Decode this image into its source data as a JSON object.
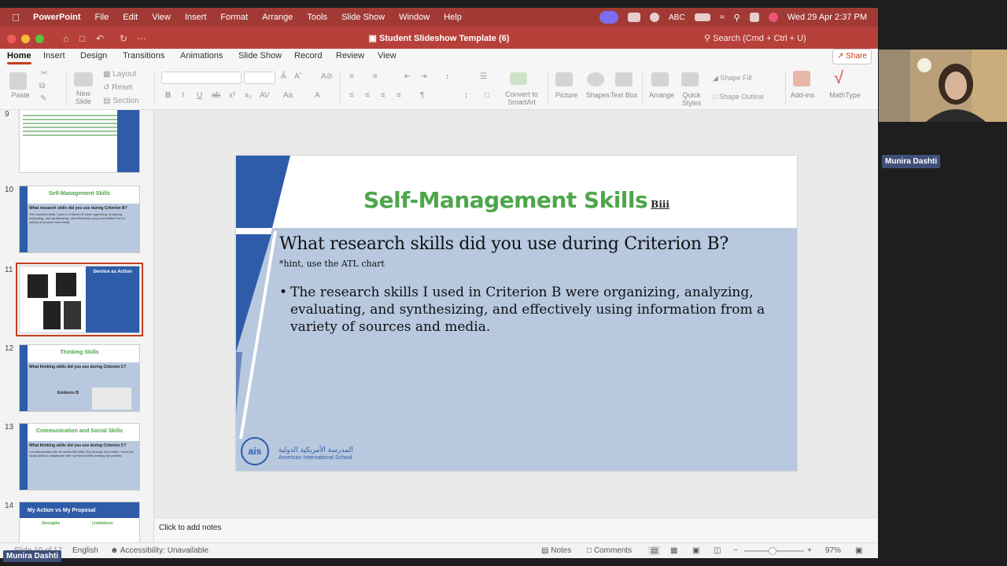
{
  "menubar": {
    "app": "PowerPoint",
    "items": [
      "File",
      "Edit",
      "View",
      "Insert",
      "Format",
      "Arrange",
      "Tools",
      "Slide Show",
      "Window",
      "Help"
    ],
    "input_label": "ABC",
    "clock": "Wed 29 Apr  2:37 PM"
  },
  "window": {
    "title": "Student Slideshow Template (6)",
    "search_placeholder": "Search (Cmd + Ctrl + U)"
  },
  "ribbon": {
    "tabs": [
      "Home",
      "Insert",
      "Design",
      "Transitions",
      "Animations",
      "Slide Show",
      "Record",
      "Review",
      "View"
    ],
    "active_tab": "Home",
    "share_label": "Share",
    "paste": "Paste",
    "new_slide": "New Slide",
    "layout": "Layout",
    "reset": "Reset",
    "section": "Section",
    "convert": "Convert to SmartArt",
    "picture": "Picture",
    "shapes": "Shapes",
    "text_box": "Text Box",
    "arrange": "Arrange",
    "quick_styles": "Quick Styles",
    "shape_fill": "Shape Fill",
    "shape_outline": "Shape Outline",
    "addins": "Add-ins",
    "mathtype": "MathType"
  },
  "thumbnails": [
    {
      "num": "9",
      "title": "",
      "question": "",
      "text": ""
    },
    {
      "num": "10",
      "title": "Self-Management Skills",
      "question": "What research skills did you use during Criterion B?",
      "text": "The research skills I used in Criterion B were organizing, analyzing, evaluating, and synthesizing, and effectively using information from a variety of sources and media."
    },
    {
      "num": "11",
      "title": "Service as Action",
      "question": "",
      "text": ""
    },
    {
      "num": "12",
      "title": "Thinking Skills",
      "question": "What thinking skills did you use during Criterion C?",
      "text": "Evidence B"
    },
    {
      "num": "13",
      "title": "Communication and Social Skills",
      "question": "What thinking skills did you use during Criterion C?",
      "text": "I communicated with an admin like Miss Tery through my emails. I used my social skills to collaborate with my friend while creating the posters."
    },
    {
      "num": "14",
      "title": "My Action vs My Proposal",
      "question": "Strengths",
      "text": "Limitations"
    }
  ],
  "slide": {
    "title": "Self-Management Skills",
    "title_sub": "Biii",
    "question": "What research skills did you use during Criterion B?",
    "hint": "*hint, use the ATL chart",
    "bullet": "The research skills I used in Criterion B were organizing, analyzing, evaluating, and synthesizing, and effectively using information from a variety of sources and media.",
    "logo": "ais",
    "school_ar": "المدرسة الأمريكية الدولية",
    "school_en": "American International School",
    "colors": {
      "accent_blue": "#2e5ca8",
      "title_green": "#4ea64a",
      "body_bg": "#b7c8df"
    }
  },
  "notes_placeholder": "Click to add notes",
  "status": {
    "slide_count": "Slide 10 of 17",
    "language": "English",
    "accessibility": "Accessibility: Unavailable",
    "notes": "Notes",
    "comments": "Comments",
    "zoom": "97%"
  },
  "participant": {
    "name": "Munira Dashti"
  }
}
